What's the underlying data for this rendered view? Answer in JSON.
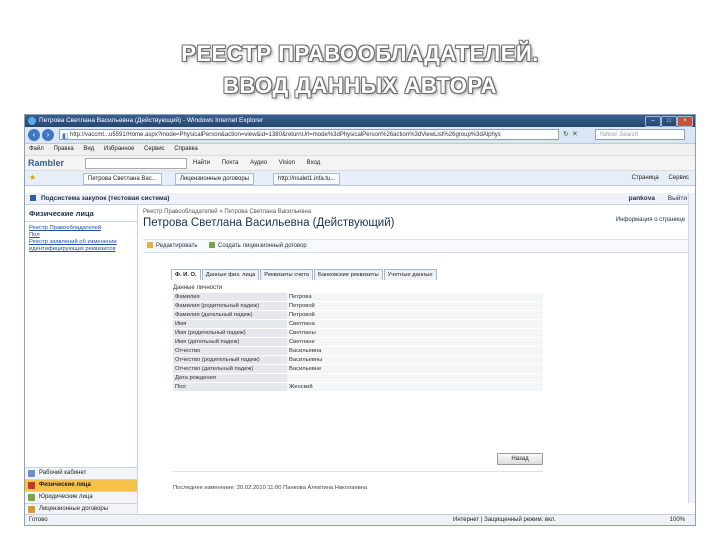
{
  "slide": {
    "title_line1": "РЕЕСТР ПРАВООБЛАДАТЕЛЕЙ.",
    "title_line2": "ВВОД ДАННЫХ АВТОРА"
  },
  "browser": {
    "window_title": "Петрова Светлана Васильевна (Действующий) - Windows Internet Explorer",
    "address": "http://vaccmt...u5591/Home.aspx?mode=PhysicalPerson&action=view&id=1380&returnUrl=mode%3dPhysicalPerson%26action%3dViewList%26group%3dAlphys",
    "search_placeholder": "Yahoo! Search",
    "menu": [
      "Файл",
      "Правка",
      "Вид",
      "Избранное",
      "Сервис",
      "Справка"
    ],
    "rambler": "Rambler",
    "toolbar_items": [
      "Найти",
      "Почта",
      "Аудио",
      "Vision",
      "Вход"
    ],
    "tabs": [
      "Петрова Светлана Вас...",
      "Лицензионные договоры",
      "http://nsalet1.infa.tu..."
    ],
    "tabbar_right": [
      "Страница",
      "Сервис"
    ]
  },
  "app": {
    "system_bar": "Подсистема закупок (тестовая система)",
    "user": "pankova",
    "logout": "Выйти",
    "sidebar_title": "Физические лица",
    "sidebar_links": [
      "Реестр Правообладателей",
      "Пол",
      "Реестр заявлений об изменении идентифицирующих реквизитов"
    ],
    "sidebar_nav": [
      {
        "label": "Рабочий кабинет",
        "active": false
      },
      {
        "label": "Физические лица",
        "active": true
      },
      {
        "label": "Юридические лица",
        "active": false
      },
      {
        "label": "Лицензионные договоры",
        "active": false
      }
    ],
    "breadcrumb": "Реестр Правообладателей » Петрова Светлана Васильевна",
    "person_title": "Петрова Светлана Васильевна (Действующий)",
    "info_link": "Информация о странице",
    "actions": [
      "Редактировать",
      "Создать лицензионный договор"
    ],
    "form_tabs": [
      {
        "label": "Ф. И. О.",
        "active": true
      },
      {
        "label": "Данные физ. лица",
        "active": false
      },
      {
        "label": "Реквизиты счета",
        "active": false
      },
      {
        "label": "Банковские реквизиты",
        "active": false
      },
      {
        "label": "Учетные данные",
        "active": false
      }
    ],
    "section_title": "Данные личности",
    "fields": [
      {
        "label": "Фамилия",
        "value": "Петрова"
      },
      {
        "label": "Фамилия (родительный падеж)",
        "value": "Петровой"
      },
      {
        "label": "Фамилия (дательный падеж)",
        "value": "Петровой"
      },
      {
        "label": "Имя",
        "value": "Светлана"
      },
      {
        "label": "Имя (родительный падеж)",
        "value": "Светланы"
      },
      {
        "label": "Имя (дательный падеж)",
        "value": "Светлане"
      },
      {
        "label": "Отчество",
        "value": "Васильевна"
      },
      {
        "label": "Отчество (родительный падеж)",
        "value": "Васильевны"
      },
      {
        "label": "Отчество (дательный падеж)",
        "value": "Васильевне"
      },
      {
        "label": "Дата рождения",
        "value": ""
      },
      {
        "label": "Пол",
        "value": "Женский"
      }
    ],
    "save_button": "Назад",
    "last_change": "Последнее изменение: 20.02.2010 11:00 Панкова Алевтина Николаевна"
  },
  "status": {
    "left": "Готово",
    "zone": "Интернет | Защищенный режим: вкл.",
    "zoom": "100%"
  }
}
